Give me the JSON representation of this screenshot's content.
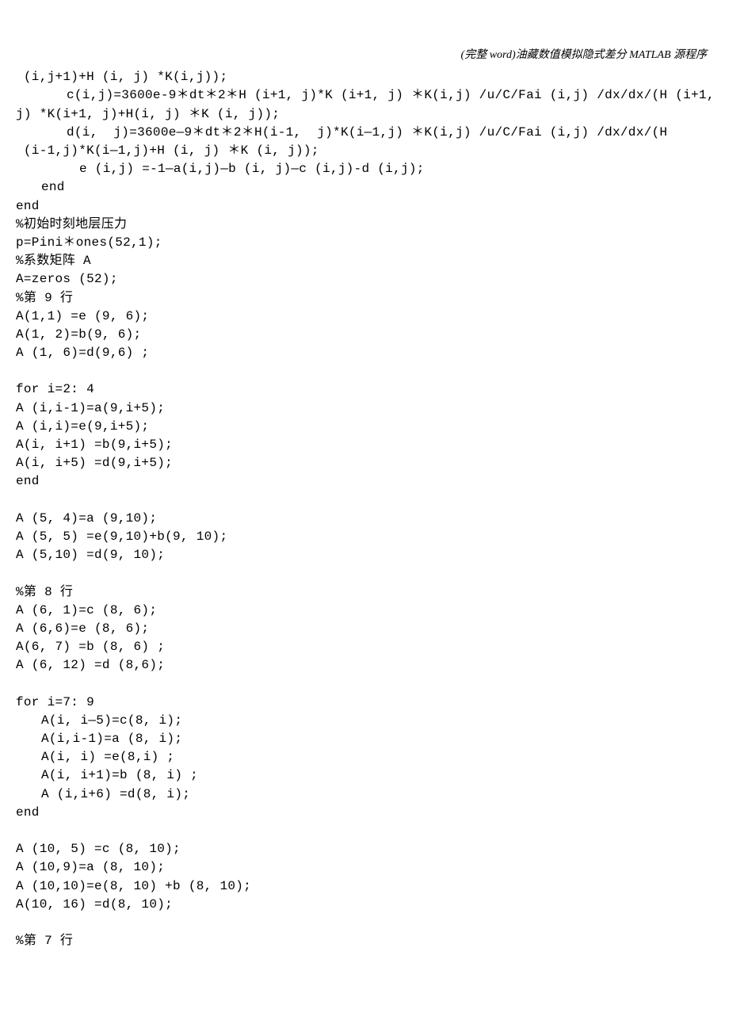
{
  "header": "(完整 word)油藏数值模拟隐式差分 MATLAB 源程序",
  "lines": [
    {
      "cls": "",
      "text": " (i,j+1)+H (i, j) *K(i,j));"
    },
    {
      "cls": "indent2",
      "text": "c(i,j)=3600e-9＊dt＊2＊H (i+1, j)*K (i+1, j) ＊K(i,j) /u/C/Fai (i,j) /dx/dx/(H (i+1,"
    },
    {
      "cls": "",
      "text": "j) *K(i+1, j)+H(i, j) ＊K (i, j));"
    },
    {
      "cls": "indent2",
      "text": "d(i,  j)=3600e—9＊dt＊2＊H(i-1,  j)*K(i—1,j) ＊K(i,j) /u/C/Fai (i,j) /dx/dx/(H"
    },
    {
      "cls": "",
      "text": " (i-1,j)*K(i—1,j)+H (i, j) ＊K (i, j));"
    },
    {
      "cls": "indent3",
      "text": "e (i,j) =-1—a(i,j)—b (i, j)—c (i,j)-d (i,j);"
    },
    {
      "cls": "indent1",
      "text": "end"
    },
    {
      "cls": "",
      "text": "end"
    },
    {
      "cls": "",
      "text": "%初始时刻地层压力"
    },
    {
      "cls": "",
      "text": "p=Pini＊ones(52,1);"
    },
    {
      "cls": "",
      "text": "%系数矩阵 A"
    },
    {
      "cls": "",
      "text": "A=zeros (52);"
    },
    {
      "cls": "",
      "text": "%第 9 行"
    },
    {
      "cls": "",
      "text": "A(1,1) =e (9, 6);"
    },
    {
      "cls": "",
      "text": "A(1, 2)=b(9, 6);"
    },
    {
      "cls": "",
      "text": "A (1, 6)=d(9,6) ;"
    },
    {
      "cls": "",
      "text": ""
    },
    {
      "cls": "",
      "text": "for i=2: 4"
    },
    {
      "cls": "",
      "text": "A (i,i-1)=a(9,i+5);"
    },
    {
      "cls": "",
      "text": "A (i,i)=e(9,i+5);"
    },
    {
      "cls": "",
      "text": "A(i, i+1) =b(9,i+5);"
    },
    {
      "cls": "",
      "text": "A(i, i+5) =d(9,i+5);"
    },
    {
      "cls": "",
      "text": "end"
    },
    {
      "cls": "",
      "text": ""
    },
    {
      "cls": "",
      "text": "A (5, 4)=a (9,10);"
    },
    {
      "cls": "",
      "text": "A (5, 5) =e(9,10)+b(9, 10);"
    },
    {
      "cls": "",
      "text": "A (5,10) =d(9, 10);"
    },
    {
      "cls": "",
      "text": ""
    },
    {
      "cls": "",
      "text": "%第 8 行"
    },
    {
      "cls": "",
      "text": "A (6, 1)=c (8, 6);"
    },
    {
      "cls": "",
      "text": "A (6,6)=e (8, 6);"
    },
    {
      "cls": "",
      "text": "A(6, 7) =b (8, 6) ;"
    },
    {
      "cls": "",
      "text": "A (6, 12) =d (8,6);"
    },
    {
      "cls": "",
      "text": ""
    },
    {
      "cls": "",
      "text": "for i=7: 9"
    },
    {
      "cls": "indent1",
      "text": "A(i, i—5)=c(8, i);"
    },
    {
      "cls": "indent1",
      "text": "A(i,i-1)=a (8, i);"
    },
    {
      "cls": "indent1",
      "text": "A(i, i) =e(8,i) ;"
    },
    {
      "cls": "indent1",
      "text": "A(i, i+1)=b (8, i) ;"
    },
    {
      "cls": "indent1",
      "text": "A (i,i+6) =d(8, i);"
    },
    {
      "cls": "",
      "text": "end"
    },
    {
      "cls": "",
      "text": ""
    },
    {
      "cls": "",
      "text": "A (10, 5) =c (8, 10);"
    },
    {
      "cls": "",
      "text": "A (10,9)=a (8, 10);"
    },
    {
      "cls": "",
      "text": "A (10,10)=e(8, 10) +b (8, 10);"
    },
    {
      "cls": "",
      "text": "A(10, 16) =d(8, 10);"
    },
    {
      "cls": "",
      "text": ""
    },
    {
      "cls": "",
      "text": "%第 7 行"
    }
  ]
}
